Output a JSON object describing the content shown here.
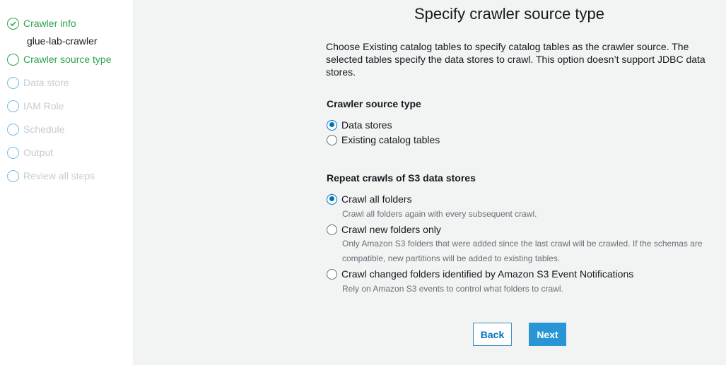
{
  "sidebar": {
    "steps": [
      {
        "label": "Crawler info",
        "state": "done"
      },
      {
        "label": "Crawler source type",
        "state": "current"
      },
      {
        "label": "Data store",
        "state": "pending"
      },
      {
        "label": "IAM Role",
        "state": "pending"
      },
      {
        "label": "Schedule",
        "state": "pending"
      },
      {
        "label": "Output",
        "state": "pending"
      },
      {
        "label": "Review all steps",
        "state": "pending"
      }
    ],
    "crawler_name": "glue-lab-crawler"
  },
  "main": {
    "title": "Specify crawler source type",
    "description": "Choose Existing catalog tables to specify catalog tables as the crawler source. The selected tables specify the data stores to crawl. This option doesn’t support JDBC data stores.",
    "source_type": {
      "label": "Crawler source type",
      "options": [
        {
          "label": "Data stores",
          "checked": true
        },
        {
          "label": "Existing catalog tables",
          "checked": false
        }
      ]
    },
    "repeat_crawls": {
      "label": "Repeat crawls of S3 data stores",
      "options": [
        {
          "label": "Crawl all folders",
          "checked": true,
          "help": "Crawl all folders again with every subsequent crawl."
        },
        {
          "label": "Crawl new folders only",
          "checked": false,
          "help_line1": "Only Amazon S3 folders that were added since the last crawl will be crawled. If the schemas are",
          "help_line2": "compatible, new partitions will be added to existing tables."
        },
        {
          "label": "Crawl changed folders identified by Amazon S3 Event Notifications",
          "checked": false,
          "help": "Rely on Amazon S3 events to control what folders to crawl."
        }
      ]
    },
    "buttons": {
      "back": "Back",
      "next": "Next"
    }
  },
  "colors": {
    "success": "#30a14e",
    "accent": "#0073bb",
    "primary_button": "#2a95d5"
  }
}
